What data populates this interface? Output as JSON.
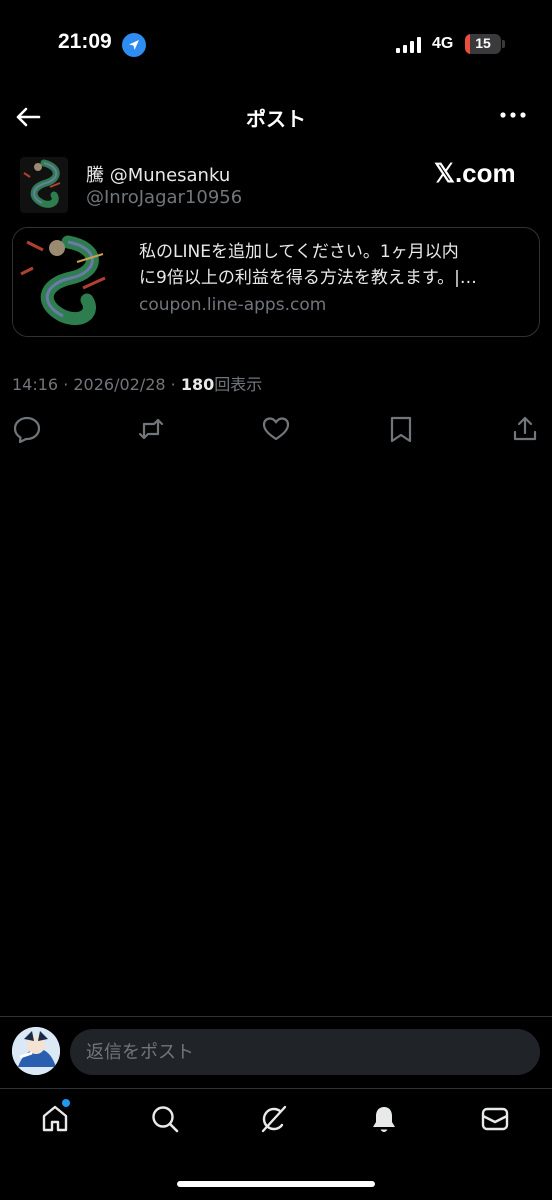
{
  "status_bar": {
    "time": "21:09",
    "network": "4G",
    "battery": "15",
    "battery_level_percent": 15,
    "battery_color": "#eb4e3d",
    "location_icon": "location-arrow-icon"
  },
  "header": {
    "title": "ポスト",
    "back_icon": "arrow-left-icon",
    "more_icon": "more-horizontal-icon"
  },
  "post": {
    "author_name": "騰 @Munesanku",
    "author_handle": "@InroJagar10956",
    "source_label": "𝕏.com",
    "card": {
      "line1": "私のLINEを追加してください。1ヶ月以内",
      "line2": "に9倍以上の利益を得る方法を教えます。|…",
      "domain": "coupon.line-apps.com"
    },
    "meta": {
      "timestamp": "14:16 · 2026/02/28 · ",
      "views_count": "180",
      "views_label": "回表示"
    },
    "actions": [
      "reply-icon",
      "retweet-icon",
      "like-icon",
      "bookmark-icon",
      "share-icon"
    ]
  },
  "reply_bar": {
    "placeholder": "返信をポスト"
  },
  "bottom_nav": {
    "items": [
      "home-icon",
      "search-icon",
      "grok-icon",
      "notifications-icon",
      "messages-icon"
    ],
    "accent_color": "#1d9bf0"
  }
}
